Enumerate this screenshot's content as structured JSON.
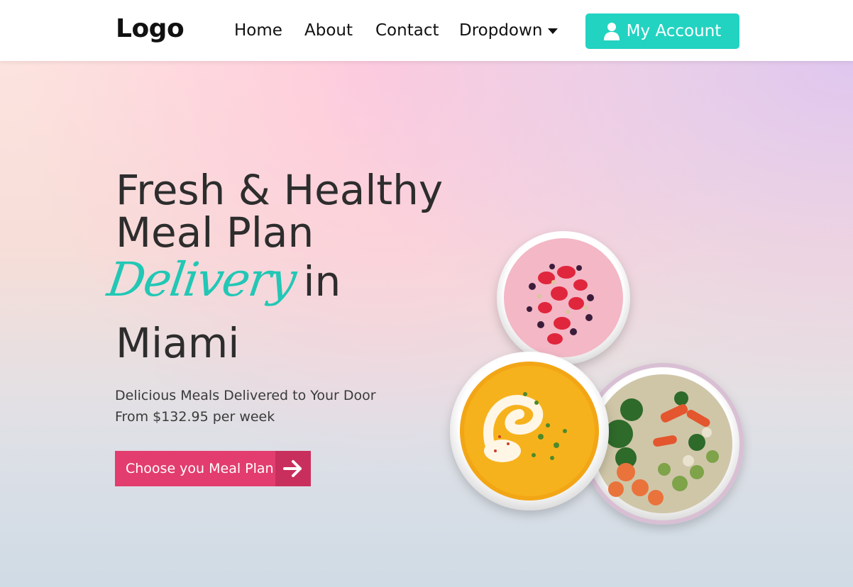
{
  "nav": {
    "logo": "Logo",
    "links": [
      "Home",
      "About",
      "Contact",
      "Dropdown"
    ],
    "account_label": "My Account",
    "accent_color": "#22d3c1"
  },
  "hero": {
    "headline_line1": "Fresh & Healthy",
    "headline_line2": "Meal Plan",
    "script_word": "Delivery",
    "in_word": "in",
    "city": "Miami",
    "subtext": "Delicious Meals Delivered to Your Door From $132.95 per week",
    "cta_label": "Choose you Meal Plan",
    "cta_color": "#e23d6e"
  },
  "icons": {
    "account": "user-icon",
    "dropdown": "caret-down-icon",
    "cta": "arrow-right-icon"
  }
}
